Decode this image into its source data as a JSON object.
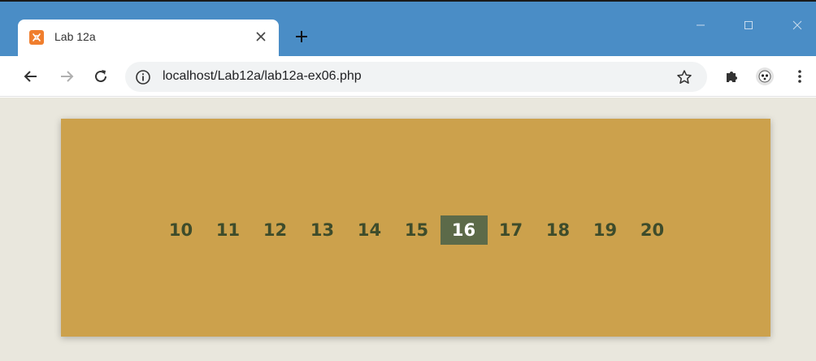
{
  "browser": {
    "tab": {
      "title": "Lab 12a",
      "favicon_icon": "xampp-icon",
      "close_icon": "close-icon"
    },
    "new_tab_icon": "plus-icon",
    "window_controls": [
      "minimize-icon",
      "maximize-icon",
      "close-icon"
    ],
    "toolbar": {
      "back_icon": "arrow-left-icon",
      "forward_icon": "arrow-right-icon",
      "reload_icon": "reload-icon",
      "url": "localhost/Lab12a/lab12a-ex06.php",
      "info_icon": "info-icon",
      "star_icon": "star-icon",
      "extensions_icon": "puzzle-icon",
      "profile_icon": "avatar-icon",
      "menu_icon": "kebab-menu-icon"
    },
    "colors": {
      "titlebar": "#4a8dc6",
      "toolbar": "#ffffff",
      "omnibox": "#f1f3f4"
    }
  },
  "page": {
    "background": "#e9e7dd",
    "panel_color": "#cca14c",
    "text_color": "#3e4c2b",
    "active_bg": "#5c6a49",
    "active_text": "#ffffff",
    "numbers": [
      "10",
      "11",
      "12",
      "13",
      "14",
      "15",
      "16",
      "17",
      "18",
      "19",
      "20"
    ],
    "active_number": "16"
  }
}
